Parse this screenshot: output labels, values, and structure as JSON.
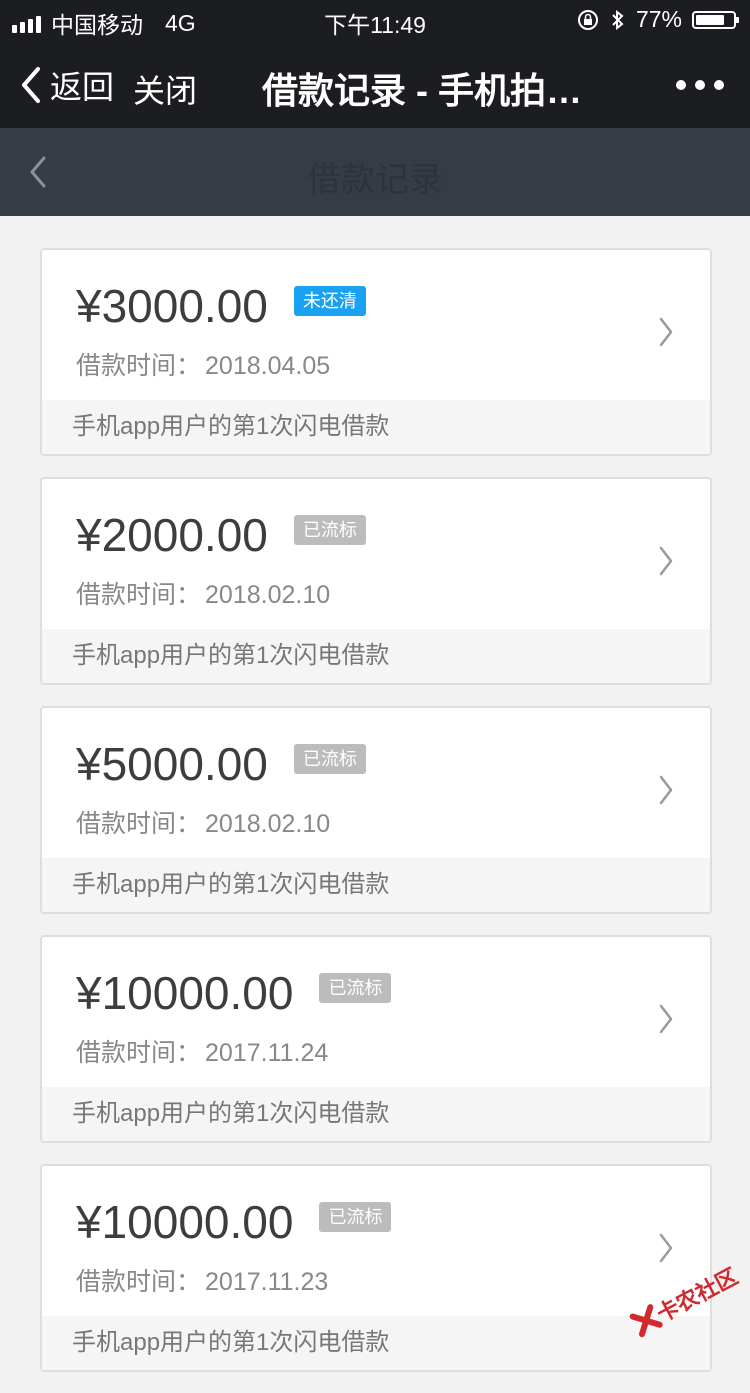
{
  "status_bar": {
    "carrier": "中国移动",
    "network": "4G",
    "time": "下午11:49",
    "battery_percent": "77%",
    "battery_level": 0.77
  },
  "nav": {
    "back_label": "返回",
    "close_label": "关闭",
    "title": "借款记录 - 手机拍…"
  },
  "subheader": {
    "title": "借款记录"
  },
  "records": [
    {
      "amount": "¥3000.00",
      "status": "未还清",
      "status_color": "#1aa1f2",
      "date_label": "借款时间：",
      "date": "2018.04.05",
      "desc": "手机app用户的第1次闪电借款"
    },
    {
      "amount": "¥2000.00",
      "status": "已流标",
      "status_color": "#bcbcbc",
      "date_label": "借款时间：",
      "date": "2018.02.10",
      "desc": "手机app用户的第1次闪电借款"
    },
    {
      "amount": "¥5000.00",
      "status": "已流标",
      "status_color": "#bcbcbc",
      "date_label": "借款时间：",
      "date": "2018.02.10",
      "desc": "手机app用户的第1次闪电借款"
    },
    {
      "amount": "¥10000.00",
      "status": "已流标",
      "status_color": "#bcbcbc",
      "date_label": "借款时间：",
      "date": "2017.11.24",
      "desc": "手机app用户的第1次闪电借款"
    },
    {
      "amount": "¥10000.00",
      "status": "已流标",
      "status_color": "#bcbcbc",
      "date_label": "借款时间：",
      "date": "2017.11.23",
      "desc": "手机app用户的第1次闪电借款"
    }
  ],
  "watermark": {
    "text": "卡农社区"
  },
  "colors": {
    "bar_bg": "#1c1d20",
    "subheader_bg": "#363c46",
    "page_bg": "#f2f2f2",
    "unpaid_badge": "#1aa1f2",
    "failed_badge": "#bcbcbc"
  }
}
